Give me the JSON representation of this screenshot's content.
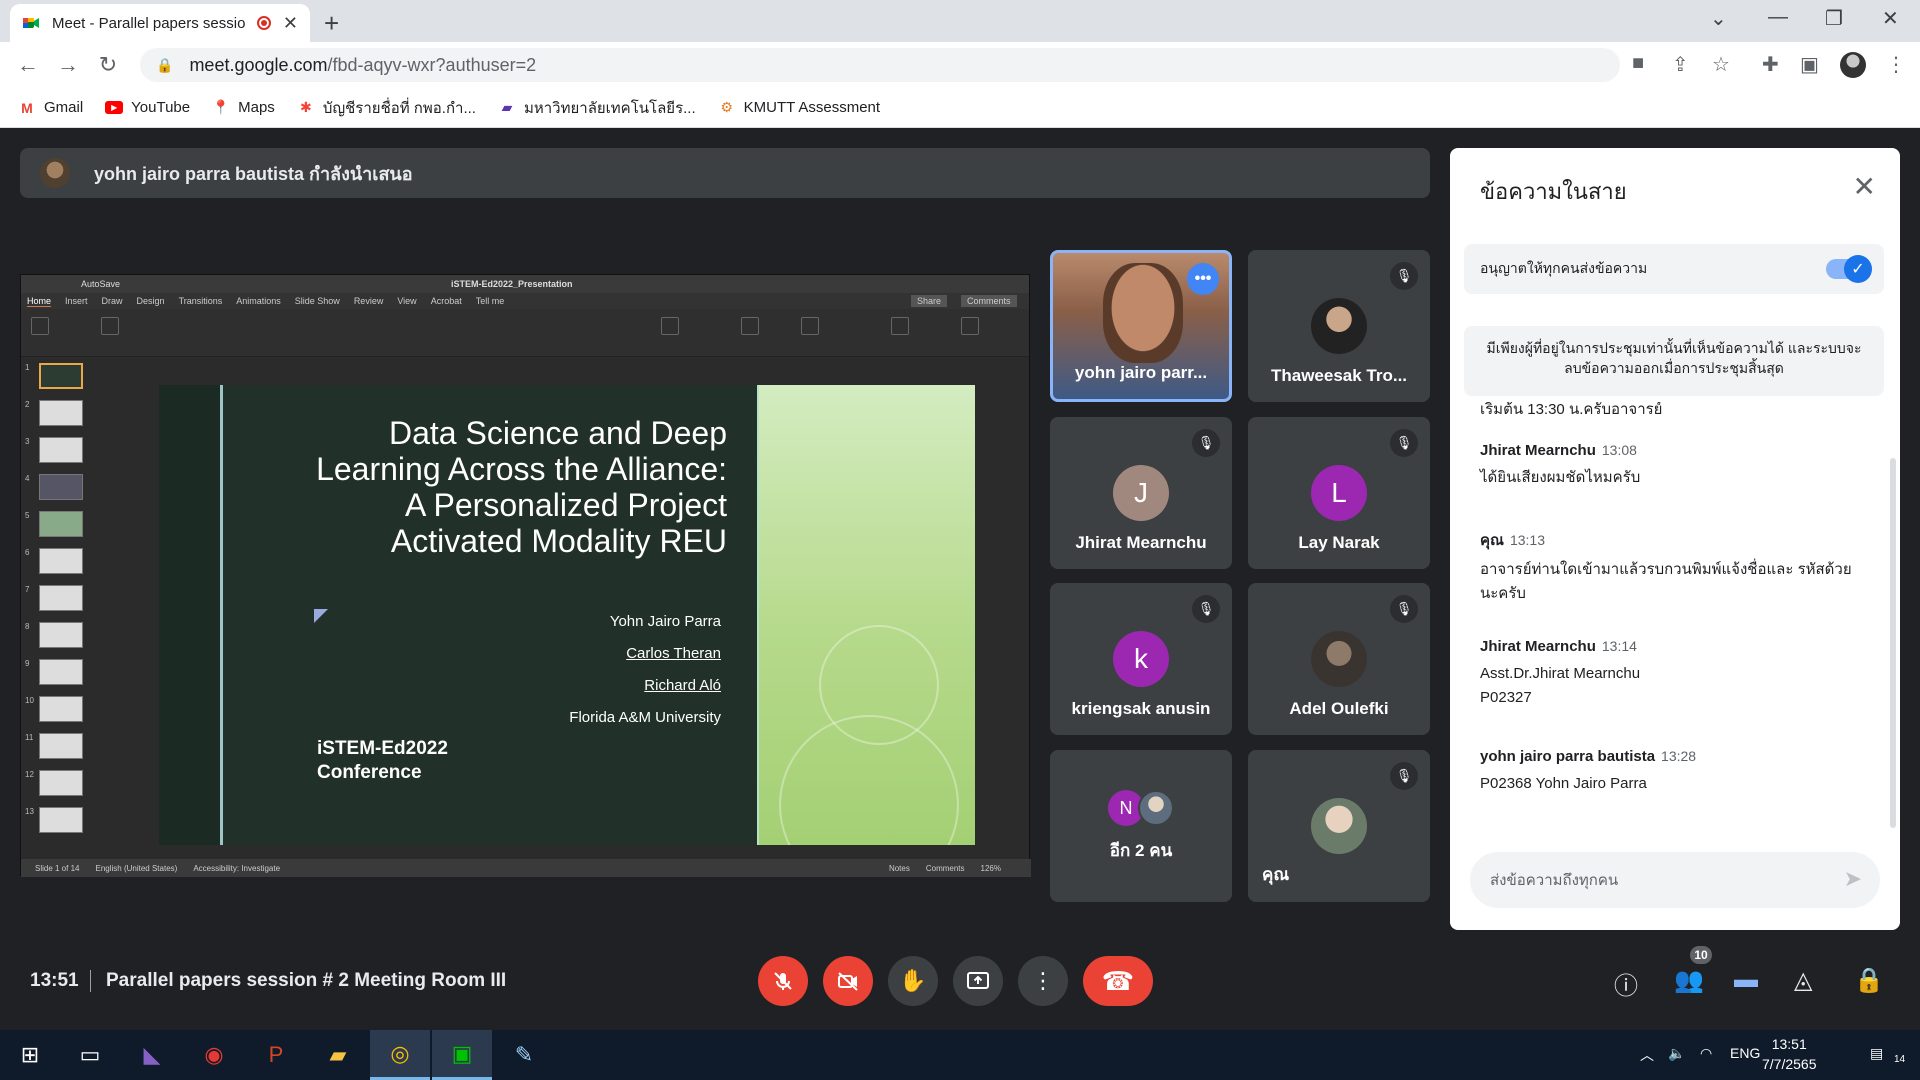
{
  "browser": {
    "tab_title": "Meet - Parallel papers sessio",
    "url_host": "meet.google.com",
    "url_rest": "/fbd-aqyv-wxr?authuser=2",
    "bookmarks": [
      {
        "label": "Gmail",
        "icon": "gmail-icon",
        "color": "#ea4335"
      },
      {
        "label": "YouTube",
        "icon": "youtube-icon",
        "color": "#ff0000"
      },
      {
        "label": "Maps",
        "icon": "maps-icon",
        "color": "#34a853"
      },
      {
        "label": "บัญชีรายชื่อที่ กพอ.กำ...",
        "icon": "joomla-icon",
        "color": "#f44336"
      },
      {
        "label": "มหาวิทยาลัยเทคโนโลยีร...",
        "icon": "university-icon",
        "color": "#5e35b1"
      },
      {
        "label": "KMUTT Assessment",
        "icon": "kmutt-icon",
        "color": "#e67c22"
      }
    ]
  },
  "presenting": {
    "text": "yohn jairo parra bautista กำลังนำเสนอ"
  },
  "ppt": {
    "doc_title": "iSTEM-Ed2022_Presentation",
    "autosave": "AutoSave",
    "menu": [
      "Home",
      "Insert",
      "Draw",
      "Design",
      "Transitions",
      "Animations",
      "Slide Show",
      "Review",
      "View",
      "Acrobat",
      "Tell me"
    ],
    "share": "Share",
    "comments": "Comments",
    "slide_numbers": [
      "1",
      "2",
      "3",
      "4",
      "5",
      "6",
      "7",
      "8",
      "9",
      "10",
      "11",
      "12",
      "13"
    ],
    "slide": {
      "title": "Data Science and Deep Learning Across the Alliance: A Personalized Project Activated Modality REU",
      "authors": [
        "Yohn Jairo Parra",
        "Carlos Theran",
        "Richard Aló",
        "Florida A&M University"
      ],
      "conference_line1": "iSTEM-Ed2022",
      "conference_line2": "Conference"
    },
    "status": {
      "slide_of": "Slide 1 of 14",
      "language": "English (United States)",
      "accessibility": "Accessibility: Investigate",
      "notes": "Notes",
      "comments": "Comments",
      "zoom": "126%"
    }
  },
  "participants": [
    {
      "name": "yohn jairo parr...",
      "type": "video"
    },
    {
      "name": "Thaweesak Tro...",
      "type": "photo",
      "muted": true
    },
    {
      "name": "Jhirat Mearnchu",
      "initial": "J",
      "color": "#a1887f",
      "muted": true
    },
    {
      "name": "Lay Narak",
      "initial": "L",
      "color": "#9c27b0",
      "muted": true
    },
    {
      "name": "kriengsak anusin",
      "initial": "k",
      "color": "#9c27b0",
      "muted": true
    },
    {
      "name": "Adel Oulefki",
      "type": "photo",
      "muted": true
    },
    {
      "name": "อีก 2 คน",
      "initial": "N",
      "color": "#9c27b0"
    },
    {
      "name": "คุณ",
      "type": "photo",
      "muted": true
    }
  ],
  "chat": {
    "title": "ข้อความในสาย",
    "allow_label": "อนุญาตให้ทุกคนส่งข้อความ",
    "notice": "มีเพียงผู้ที่อยู่ในการประชุมเท่านั้นที่เห็นข้อความได้ และระบบจะลบข้อความออกเมื่อการประชุมสิ้นสุด",
    "partial_line": "เริ่มต้น 13:30 น.ครับอาจารย์",
    "messages": [
      {
        "sender": "Jhirat Mearnchu",
        "time": "13:08",
        "lines": [
          "ได้ยินเสียงผมชัดไหมครับ"
        ]
      },
      {
        "sender": "คุณ",
        "time": "13:13",
        "lines": [
          "อาจารย์ท่านใดเข้ามาแล้วรบกวนพิมพ์แจ้งชื่อและ รหัสด้วย",
          "นะครับ"
        ]
      },
      {
        "sender": "Jhirat Mearnchu",
        "time": "13:14",
        "lines": [
          "Asst.Dr.Jhirat   Mearnchu",
          "P02327"
        ]
      },
      {
        "sender": "yohn jairo parra bautista",
        "time": "13:28",
        "lines": [
          "P02368 Yohn Jairo Parra"
        ]
      }
    ],
    "input_placeholder": "ส่งข้อความถึงทุกคน"
  },
  "meeting": {
    "clock": "13:51",
    "name": "Parallel papers session # 2 Meeting Room III",
    "people_count": "10"
  },
  "taskbar": {
    "lang": "ENG",
    "time": "13:51",
    "date": "7/7/2565",
    "notif_count": "14"
  }
}
